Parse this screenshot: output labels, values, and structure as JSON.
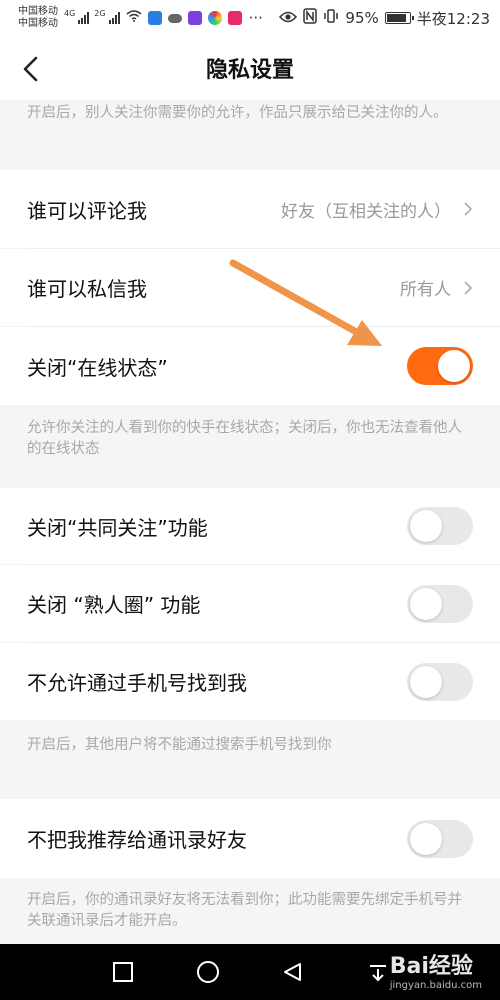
{
  "statusbar": {
    "carrier1": "中国移动",
    "carrier2": "中国移动",
    "net1": "4G",
    "net2": "2G",
    "battery": "95%",
    "time": "半夜12:23"
  },
  "header": {
    "title": "隐私设置"
  },
  "notes": {
    "top": "开启后，别人关注你需要你的允许，作品只展示给已关注你的人。",
    "online": "允许你关注的人看到你的快手在线状态；关闭后，你也无法查看他人的在线状态",
    "phone": "开启后，其他用户将不能通过搜索手机号找到你",
    "contacts": "开启后，你的通讯录好友将无法看到你；此功能需要先绑定手机号并关联通讯录后才能开启。"
  },
  "rows": {
    "comment": {
      "label": "谁可以评论我",
      "value": "好友（互相关注的人）"
    },
    "message": {
      "label": "谁可以私信我",
      "value": "所有人"
    },
    "online": {
      "label": "关闭“在线状态”",
      "on": true
    },
    "mutual": {
      "label": "关闭“共同关注”功能",
      "on": false
    },
    "acquaint": {
      "label": "关闭 “熟人圈” 功能",
      "on": false
    },
    "phone": {
      "label": "不允许通过手机号找到我",
      "on": false
    },
    "contacts": {
      "label": "不把我推荐给通讯录好友",
      "on": false
    }
  },
  "watermark": {
    "brand": "Bai经验",
    "url": "jingyan.baidu.com"
  },
  "colors": {
    "accent": "#ff6a10",
    "arrow": "#f0944a"
  }
}
